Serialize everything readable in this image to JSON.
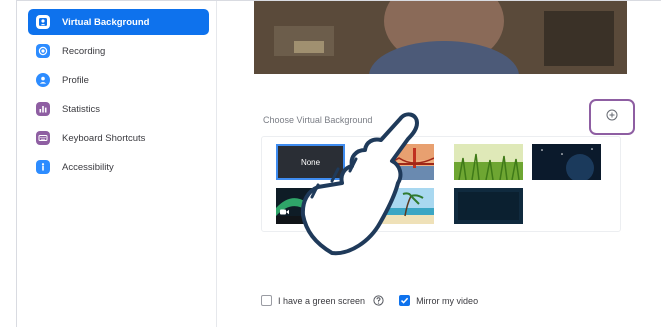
{
  "sidebar": {
    "items": [
      {
        "label": "Virtual Background",
        "icon": "person-badge-icon",
        "active": true
      },
      {
        "label": "Recording",
        "icon": "record-icon"
      },
      {
        "label": "Profile",
        "icon": "user-icon"
      },
      {
        "label": "Statistics",
        "icon": "bar-chart-icon"
      },
      {
        "label": "Keyboard Shortcuts",
        "icon": "keyboard-icon"
      },
      {
        "label": "Accessibility",
        "icon": "accessibility-icon"
      }
    ]
  },
  "main": {
    "section_title": "Choose Virtual Background",
    "add_icon": "plus-circle-icon",
    "backgrounds": [
      {
        "label": "None",
        "selected": true
      },
      {
        "label": "",
        "scene": "golden-gate-bridge"
      },
      {
        "label": "",
        "scene": "grass"
      },
      {
        "label": "",
        "scene": "space"
      },
      {
        "label": "",
        "scene": "aurora"
      },
      {
        "label": "",
        "scene": "beach"
      },
      {
        "label": "",
        "scene": "dark"
      }
    ],
    "green_screen": {
      "label": "I have a green screen",
      "checked": false,
      "help_icon": "question-circle-icon"
    },
    "mirror": {
      "label": "Mirror my video",
      "checked": true
    }
  },
  "colors": {
    "accent": "#0e72ed",
    "highlight": "#8e5ea2",
    "hand_outline": "#1f3a5a"
  }
}
